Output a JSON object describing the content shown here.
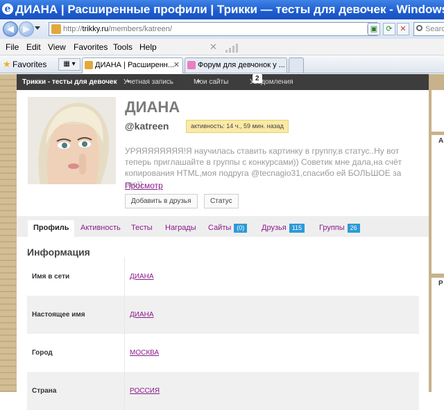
{
  "browser": {
    "title": "ДИАНА | Расширенные профили | Трикки — тесты для девочек - Windows Internet Explorer",
    "url_prefix": "http://",
    "url_host": "trikky.ru",
    "url_path": "/members/katreen/",
    "search_placeholder": "Search",
    "menu": [
      "File",
      "Edit",
      "View",
      "Favorites",
      "Tools",
      "Help"
    ],
    "favorites_label": "Favorites",
    "tabs": [
      {
        "label": "ДИАНА | Расширенн...",
        "active": true
      },
      {
        "label": "Форум для девчонок у ...",
        "active": false
      }
    ]
  },
  "site": {
    "brand": "Трикки - тесты для девочек",
    "nav": [
      "Учетная запись",
      "Мои сайты",
      "Уведомления"
    ],
    "notifications_count": "2"
  },
  "profile": {
    "name": "ДИАНА",
    "handle": "@katreen",
    "activity": "активность: 14 ч., 59 мин. назад",
    "status": "УРЯЯЯЯЯЯЯЯ!Я научилась ставить картинку в группу,в статус..Ну вот теперь приглашайте в группы с конкурсами)) Советик мне дала,на счёт копирования HTML,моя подруга @tecnagio31,спасибо ей БОЛЬШОЕ за это))",
    "view_link": "Просмотр",
    "add_friend": "Добавить в друзья",
    "status_button": "Статус"
  },
  "profile_tabs": [
    {
      "label": "Профиль",
      "count": null
    },
    {
      "label": "Активность",
      "count": null
    },
    {
      "label": "Тесты",
      "count": null
    },
    {
      "label": "Награды",
      "count": null
    },
    {
      "label": "Сайты",
      "count": "(0)"
    },
    {
      "label": "Друзья",
      "count": "115"
    },
    {
      "label": "Группы",
      "count": "26"
    }
  ],
  "info": {
    "title": "Информация",
    "rows": [
      {
        "label": "Имя в сети",
        "value": "ДИАНА"
      },
      {
        "label": "Настоящее имя",
        "value": "ДИАНА"
      },
      {
        "label": "Город",
        "value": "МОСКВА"
      },
      {
        "label": "Страна",
        "value": "РОССИЯ"
      }
    ]
  },
  "right_sidebar": {
    "letters": [
      "А",
      "Р"
    ]
  },
  "colors": {
    "link": "#8a1a8a",
    "count_badge": "#2c9ad8",
    "activity_bg": "#fbeaa6",
    "site_bar": "#3d3d3d"
  }
}
